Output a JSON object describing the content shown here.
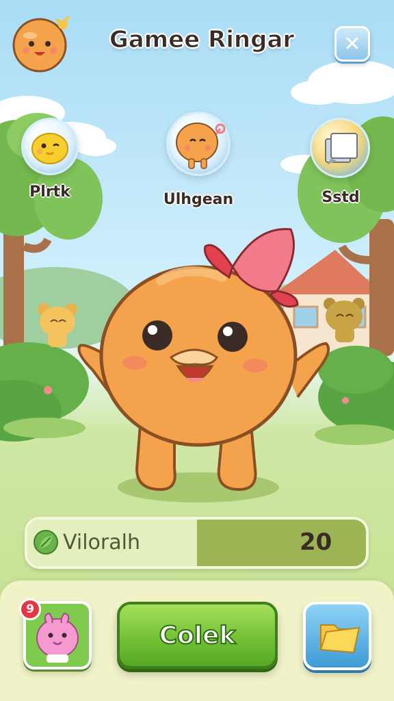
{
  "header": {
    "title": "Gamee Ringar",
    "close_label": "✕"
  },
  "slots": [
    {
      "label": "Plrtk",
      "icon": "yellow-chick-icon"
    },
    {
      "label": "Ulhgean",
      "icon": "orange-pet-icon"
    },
    {
      "label": "Sstd",
      "icon": "card-stack-icon"
    }
  ],
  "progress": {
    "label": "Viloralh",
    "value": "20",
    "fill_fraction": 0.5,
    "icon": "leaf-icon"
  },
  "bottom_bar": {
    "collect_label": "Colek",
    "pet_badge": "9",
    "pet_icon": "pink-pet-icon",
    "folder_icon": "folder-icon"
  },
  "colors": {
    "sky": "#a9dcf5",
    "grass": "#c3df8c",
    "pet_body": "#f4a24c",
    "collect_green": "#6fbe33",
    "ribbon": "#f27b8a"
  }
}
